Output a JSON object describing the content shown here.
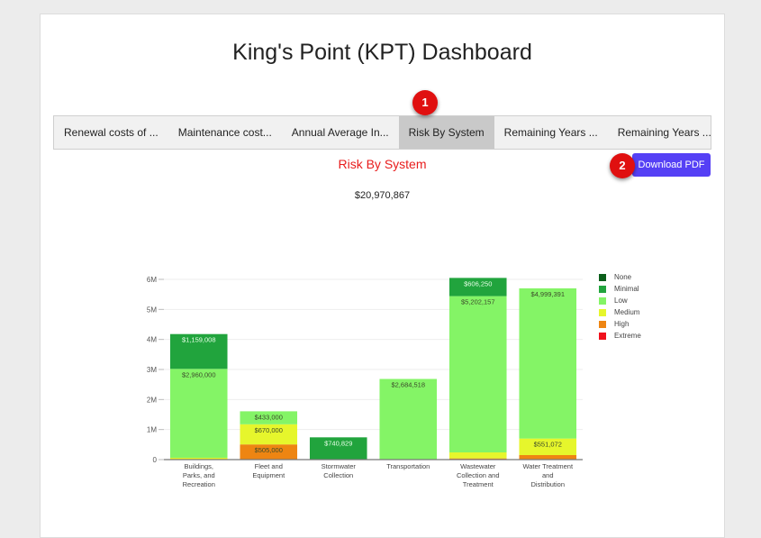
{
  "header": {
    "title": "King's Point (KPT) Dashboard"
  },
  "tabs": [
    {
      "label": "Renewal costs of ...",
      "active": false
    },
    {
      "label": "Maintenance cost...",
      "active": false
    },
    {
      "label": "Annual Average In...",
      "active": false
    },
    {
      "label": "Risk By System",
      "active": true
    },
    {
      "label": "Remaining Years ...",
      "active": false
    },
    {
      "label": "Remaining Years ...",
      "active": false
    }
  ],
  "annotations": {
    "badge_1": "1",
    "badge_2": "2"
  },
  "toolbar": {
    "download_label": "Download PDF"
  },
  "colors": {
    "accent_button": "#5540f5",
    "chart_title": "#e81c1c",
    "badge": "#e01010"
  },
  "chart_data": {
    "type": "bar",
    "stacked": true,
    "title": "Risk By System",
    "subtitle": "$20,970,867",
    "xlabel": "",
    "ylabel": "",
    "ylim": [
      0,
      6000000
    ],
    "yticks": [
      0,
      1000000,
      2000000,
      3000000,
      4000000,
      5000000,
      6000000
    ],
    "ytick_labels": [
      "0",
      "1M",
      "2M",
      "3M",
      "4M",
      "5M",
      "6M"
    ],
    "grid": true,
    "legend_position": "right",
    "categories": [
      [
        "Buildings,",
        "Parks, and",
        "Recreation"
      ],
      [
        "Fleet and",
        "Equipment"
      ],
      [
        "Stormwater",
        "Collection"
      ],
      [
        "Transportation"
      ],
      [
        "Wastewater",
        "Collection and",
        "Treatment"
      ],
      [
        "Water Treatment",
        "and",
        "Distribution"
      ]
    ],
    "series": [
      {
        "name": "None",
        "color": "#0b5e1a",
        "values": [
          0,
          0,
          0,
          0,
          0,
          0
        ]
      },
      {
        "name": "Extreme",
        "color": "#f0101c",
        "values": [
          0,
          0,
          0,
          0,
          15000,
          0
        ]
      },
      {
        "name": "High",
        "color": "#ee8512",
        "values": [
          0,
          505000,
          0,
          0,
          25000,
          150000
        ]
      },
      {
        "name": "Medium",
        "color": "#e6f62c",
        "values": [
          60000,
          670000,
          0,
          0,
          200000,
          551072
        ]
      },
      {
        "name": "Low",
        "color": "#84f466",
        "values": [
          2960000,
          433000,
          0,
          2684518,
          5202157,
          4999391
        ]
      },
      {
        "name": "Minimal",
        "color": "#21a43d",
        "values": [
          1159008,
          0,
          740829,
          0,
          606250,
          0
        ]
      }
    ],
    "data_labels": [
      {
        "category": 0,
        "series": "Minimal",
        "text": "$1,159,008",
        "light": true
      },
      {
        "category": 0,
        "series": "Low",
        "text": "$2,960,000",
        "light": false
      },
      {
        "category": 1,
        "series": "Low",
        "text": "$433,000",
        "light": false
      },
      {
        "category": 1,
        "series": "Medium",
        "text": "$670,000",
        "light": false
      },
      {
        "category": 1,
        "series": "High",
        "text": "$505,000",
        "light": false
      },
      {
        "category": 2,
        "series": "Minimal",
        "text": "$740,829",
        "light": true
      },
      {
        "category": 3,
        "series": "Low",
        "text": "$2,684,518",
        "light": false
      },
      {
        "category": 4,
        "series": "Minimal",
        "text": "$606,250",
        "light": true
      },
      {
        "category": 4,
        "series": "Low",
        "text": "$5,202,157",
        "light": false
      },
      {
        "category": 5,
        "series": "Low",
        "text": "$4,999,391",
        "light": false
      },
      {
        "category": 5,
        "series": "Medium",
        "text": "$551,072",
        "light": false
      }
    ],
    "legend": [
      {
        "name": "None",
        "color": "#0b5e1a"
      },
      {
        "name": "Minimal",
        "color": "#21a43d"
      },
      {
        "name": "Low",
        "color": "#84f466"
      },
      {
        "name": "Medium",
        "color": "#e6f62c"
      },
      {
        "name": "High",
        "color": "#ee8512"
      },
      {
        "name": "Extreme",
        "color": "#f0101c"
      }
    ]
  }
}
